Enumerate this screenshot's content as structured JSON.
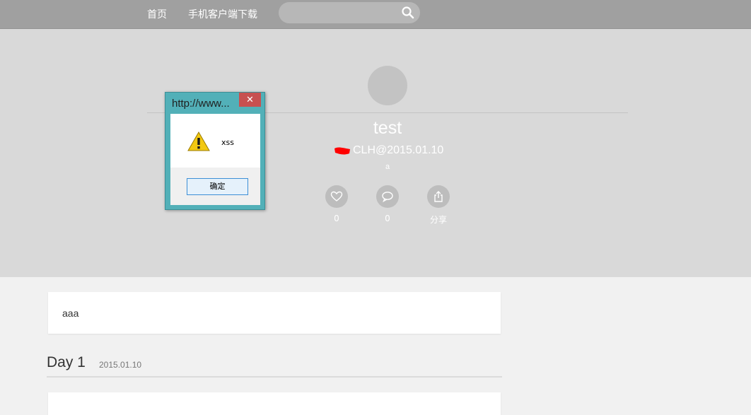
{
  "nav": {
    "home": "首页",
    "app_download": "手机客户端下载",
    "search_placeholder": "",
    "search_icon": "search-icon"
  },
  "post": {
    "title": "test",
    "author_line": "CLH@2015.01.10",
    "description": "a",
    "like_count": "0",
    "comment_count": "0",
    "share_label": "分享"
  },
  "content": {
    "summary": "aaa",
    "day_title": "Day 1",
    "day_date": "2015.01.10"
  },
  "dialog": {
    "title": "http://www...",
    "close_label": "✕",
    "message": "xss",
    "ok_label": "确定"
  },
  "colors": {
    "topbar": "#a0a0a0",
    "hero": "#d9d9d9",
    "dialog_frame": "#52b0b8",
    "close_button": "#c75050",
    "redaction": "#ff0000"
  }
}
